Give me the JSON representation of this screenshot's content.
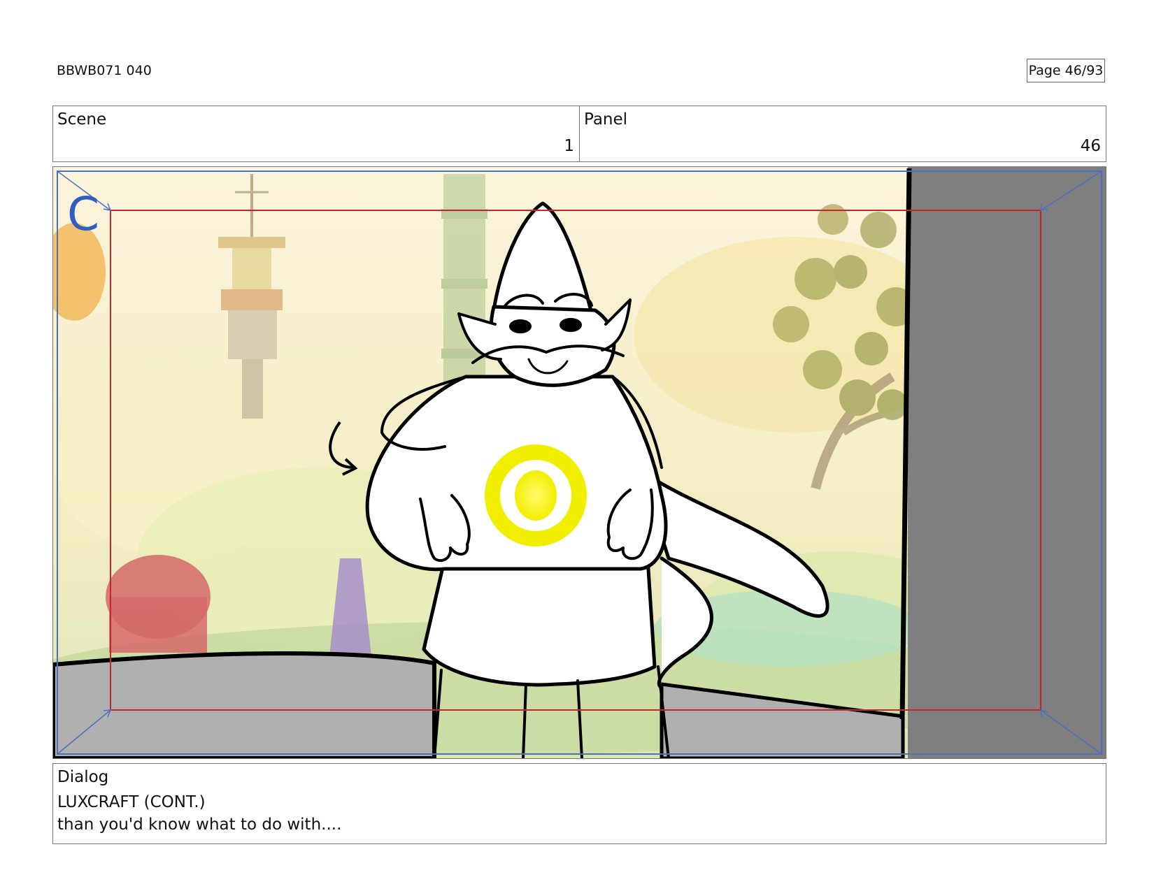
{
  "header": {
    "episode_id": "BBWB071 040",
    "page_label": "Page 46/93"
  },
  "info": {
    "scene_label": "Scene",
    "scene_value": "1",
    "panel_label": "Panel",
    "panel_value": "46"
  },
  "frame": {
    "camera_letter": "C",
    "colors": {
      "camera_letter": "#2f5fc4",
      "safe_frame": "#c4262c",
      "field_frame": "#4d6fc0",
      "glow": "#f2ee00",
      "wall": "#7f7f7f"
    }
  },
  "dialog": {
    "label": "Dialog",
    "speaker": "LUXCRAFT (CONT.)",
    "line": "than you'd know what to do with...."
  }
}
